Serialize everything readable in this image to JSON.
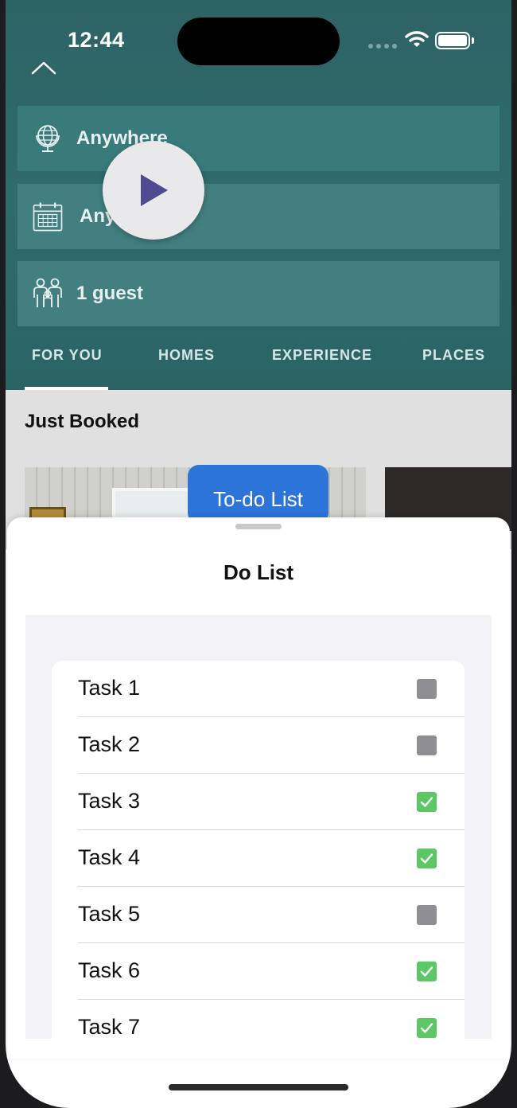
{
  "status_bar": {
    "time": "12:44"
  },
  "search": {
    "location_label": "Anywhere",
    "dates_label": "Any",
    "guests_label": "1 guest"
  },
  "tabs": [
    {
      "label": "FOR YOU",
      "active": true
    },
    {
      "label": "HOMES",
      "active": false
    },
    {
      "label": "EXPERIENCE",
      "active": false
    },
    {
      "label": "PLACES",
      "active": false
    }
  ],
  "content": {
    "section_title": "Just Booked"
  },
  "todo_button": {
    "label": "To-do List"
  },
  "sheet": {
    "title": "Do List",
    "tasks": [
      {
        "label": "Task 1",
        "done": false
      },
      {
        "label": "Task 2",
        "done": false
      },
      {
        "label": "Task 3",
        "done": true
      },
      {
        "label": "Task 4",
        "done": true
      },
      {
        "label": "Task 5",
        "done": false
      },
      {
        "label": "Task 6",
        "done": true
      },
      {
        "label": "Task 7",
        "done": true
      }
    ]
  },
  "colors": {
    "header": "#2f6a6c",
    "accent_button": "#2d74d9",
    "check_on": "#5ec765",
    "check_off": "#8e8e93"
  },
  "icons": {
    "collapse": "chevron-up-icon",
    "location": "globe-icon",
    "dates": "calendar-icon",
    "guests": "people-icon",
    "media": "play-icon",
    "checked": "checkmark-icon"
  }
}
